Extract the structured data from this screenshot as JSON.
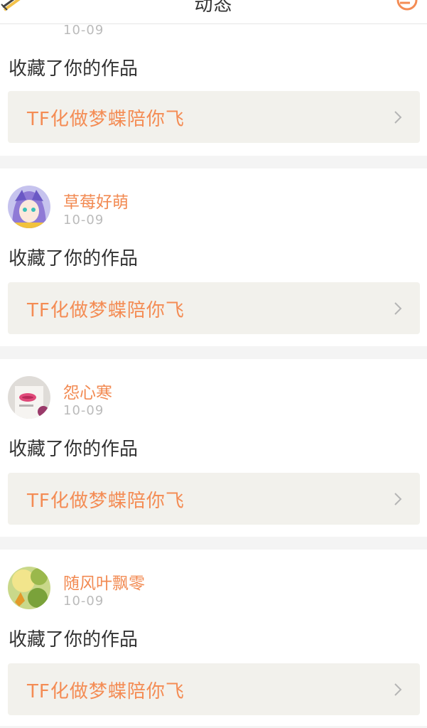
{
  "header": {
    "title": "动态"
  },
  "feed": [
    {
      "username": "",
      "time": "10-09",
      "action": "收藏了你的作品",
      "work_title": "TF化做梦蝶陪你飞",
      "avatar": "avatar-food"
    },
    {
      "username": "草莓好萌",
      "time": "10-09",
      "action": "收藏了你的作品",
      "work_title": "TF化做梦蝶陪你飞",
      "avatar": "avatar-anime-girl"
    },
    {
      "username": "怨心寒",
      "time": "10-09",
      "action": "收藏了你的作品",
      "work_title": "TF化做梦蝶陪你飞",
      "avatar": "avatar-lips-shirt"
    },
    {
      "username": "随风叶飘零",
      "time": "10-09",
      "action": "收藏了你的作品",
      "work_title": "TF化做梦蝶陪你飞",
      "avatar": "avatar-autumn-leaf"
    }
  ],
  "colors": {
    "accent": "#f48c54",
    "card_bg": "#f2f1ec",
    "separator": "#f4f4f4"
  }
}
